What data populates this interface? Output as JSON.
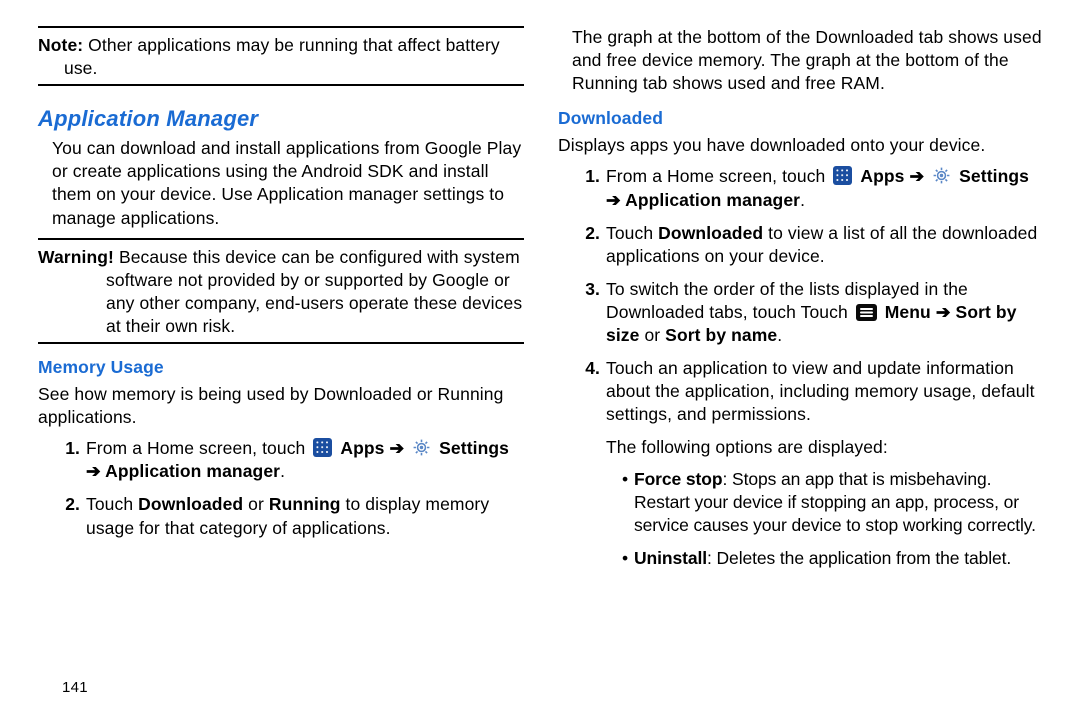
{
  "left": {
    "note_label": "Note:",
    "note_text": " Other applications may be running that affect battery use.",
    "h_appmgr": "Application Manager",
    "appmgr_body": "You can download and install applications from Google Play or create applications using the Android SDK and install them on your device. Use Application manager settings to manage applications.",
    "warn_label": "Warning!",
    "warn_text": " Because this device can be configured with system software not provided by or supported by Google or any other company, end-users operate these devices at their own risk.",
    "h_mem": "Memory Usage",
    "mem_body": "See how memory is being used by Downloaded or Running applications.",
    "step1_pre": "From a Home screen, touch ",
    "apps_lbl": "Apps",
    "arrow": "➔",
    "settings_lbl": "Settings",
    "appmgr_lbl": "Application manager",
    "step2_a": "Touch ",
    "dl_lbl": "Downloaded",
    "or": " or ",
    "run_lbl": "Running",
    "step2_b": " to display memory usage for that category of applications."
  },
  "right": {
    "topbody": "The graph at the bottom of the Downloaded tab shows used and free device memory. The graph at the bottom of the Running tab shows used and free RAM.",
    "h_dl": "Downloaded",
    "dl_body": "Displays apps you have downloaded onto your device.",
    "step1_pre": "From a Home screen, touch ",
    "apps_lbl": "Apps",
    "arrow": "➔",
    "settings_lbl": "Settings",
    "appmgr_lbl": "Application manager",
    "step2_a": "Touch ",
    "dl_lbl": "Downloaded",
    "step2_b": " to view a list of all the downloaded applications on your device.",
    "step3_a": "To switch the order of the lists displayed in the Downloaded tabs, touch Touch ",
    "menu_lbl": "Menu",
    "sortsize": "Sort by size",
    "or": " or ",
    "sortname": "Sort by name",
    "step4": "Touch an application to view and update information about the application, including memory usage, default settings, and permissions.",
    "following": "The following options are displayed:",
    "fs_lbl": "Force stop",
    "fs_txt": ": Stops an app that is misbehaving. Restart your device if stopping an app, process, or service causes your device to stop working correctly.",
    "un_lbl": "Uninstall",
    "un_txt": ": Deletes the application from the tablet."
  },
  "pagenum": "141"
}
